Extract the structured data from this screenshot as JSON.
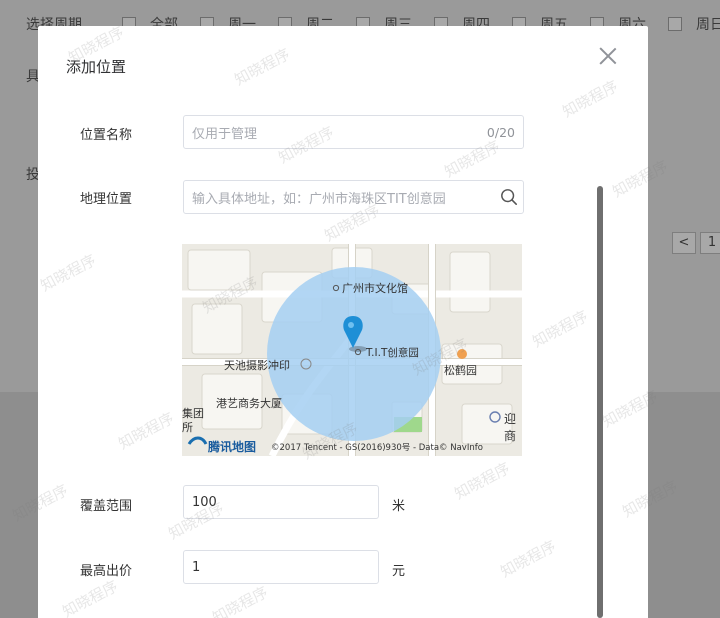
{
  "background": {
    "weekday_label": "选择周期",
    "weekdays": [
      "全部",
      "周一",
      "周二",
      "周三",
      "周四",
      "周五",
      "周六",
      "周日"
    ],
    "side_a": "具",
    "side_b": "投",
    "pager": [
      "<",
      "1"
    ]
  },
  "modal": {
    "title": "添加位置",
    "fields": {
      "name": {
        "label": "位置名称",
        "placeholder": "仅用于管理",
        "counter": "0/20"
      },
      "geo": {
        "label": "地理位置",
        "placeholder": "输入具体地址，如：广州市海珠区TIT创意园"
      },
      "range": {
        "label": "覆盖范围",
        "value": "100",
        "unit": "米"
      },
      "bid": {
        "label": "最高出价",
        "value": "1",
        "unit": "元"
      }
    }
  },
  "map": {
    "pois": {
      "culture_hall": "广州市文化馆",
      "tit": "T.I.T创意园",
      "photo": "天池摄影冲印",
      "songhe": "松鹤园",
      "gangyi": "港艺商务大厦",
      "ji1": "集团",
      "ji2": "所",
      "ying": "迎商"
    },
    "brand": "腾讯地图",
    "copyright": "©2017 Tencent - GS(2016)930号 - Data© NavInfo"
  },
  "watermark": "知晓程序",
  "colors": {
    "circle": "#a5cff2",
    "pin": "#1e8fd6",
    "border": "#dcdfe6"
  }
}
